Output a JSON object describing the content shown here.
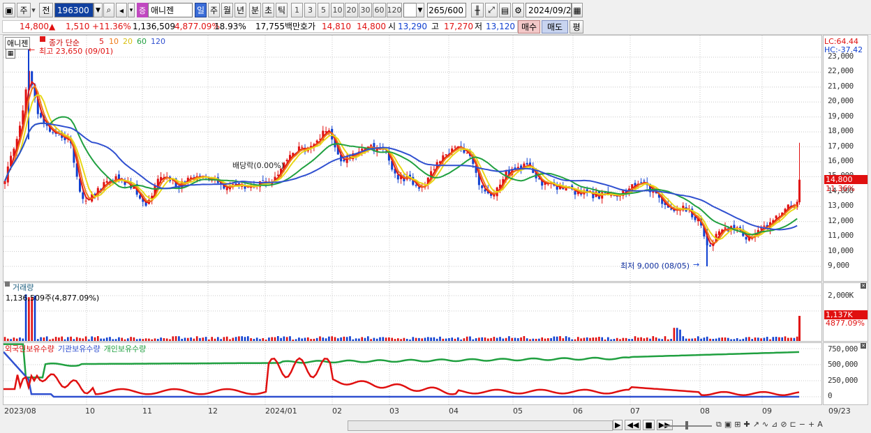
{
  "toolbar": {
    "market_buttons": [
      "주",
      "전"
    ],
    "stock_code": "196300",
    "stock_name": "애니젠",
    "name_badge": "증",
    "period_buttons": [
      "일",
      "주",
      "월",
      "년",
      "분",
      "초",
      "틱"
    ],
    "interval_buttons": [
      "1",
      "3",
      "5",
      "10",
      "20",
      "30",
      "60",
      "120"
    ],
    "bar_count": "265",
    "bar_total": "/600",
    "date": "2024/09/23"
  },
  "quote": {
    "price": "14,800",
    "change": "1,510",
    "change_pct": "+11.36%",
    "volume": "1,136,509",
    "volume_ratio": "4,877.09%",
    "turnover": "18.93%",
    "amount": "17,755백만",
    "ask_label": "호가",
    "ask": "14,810",
    "bid": "14,800",
    "open_label": "시",
    "open": "13,290",
    "high_label": "고",
    "high": "17,270",
    "low_label": "저",
    "low": "13,120",
    "buy_button": "매수",
    "sell_button": "매도",
    "avg_button": "평"
  },
  "price_pane": {
    "title": "애니젠",
    "legend_label": "종가 단순",
    "ma_periods": [
      "5",
      "10",
      "20",
      "60",
      "120"
    ],
    "ma_colors": [
      "#e01818",
      "#f07a18",
      "#e8d818",
      "#20a040",
      "#3050d0"
    ],
    "max_note": "최고 23,650 (09/01)",
    "min_note": "최저 9,000 (08/05)",
    "dividend_note": "배당락(0.00%)",
    "lc": "LC:64.44",
    "hc": "HC:-37.42",
    "last_price_tag": "14,800",
    "last_pct_tag": "11.36%",
    "y_ticks": [
      "23,000",
      "22,000",
      "21,000",
      "20,000",
      "19,000",
      "18,000",
      "17,000",
      "16,000",
      "15,000",
      "14,000",
      "13,000",
      "12,000",
      "11,000",
      "10,000",
      "9,000"
    ]
  },
  "volume_pane": {
    "title": "거래량",
    "current": "1,136,509주(4,877.09%)",
    "y_ticks": [
      "2,000K",
      "1,000K"
    ],
    "last_tag": "1,137K",
    "last_pct_tag": "4877.09%"
  },
  "holdings_pane": {
    "legend": [
      "외국인보유수량",
      "기관보유수량",
      "개인보유수량"
    ],
    "legend_colors": [
      "#e01010",
      "#3050d0",
      "#20a040"
    ],
    "y_ticks": [
      "750,000",
      "500,000",
      "250,000",
      "0"
    ]
  },
  "x_axis": [
    "2023/08",
    "10",
    "11",
    "12",
    "2024/01",
    "02",
    "03",
    "04",
    "05",
    "06",
    "07",
    "08",
    "09",
    "09/23"
  ],
  "colors": {
    "up": "#e01010",
    "down": "#1040d0",
    "grid": "#c8c8c8"
  }
}
